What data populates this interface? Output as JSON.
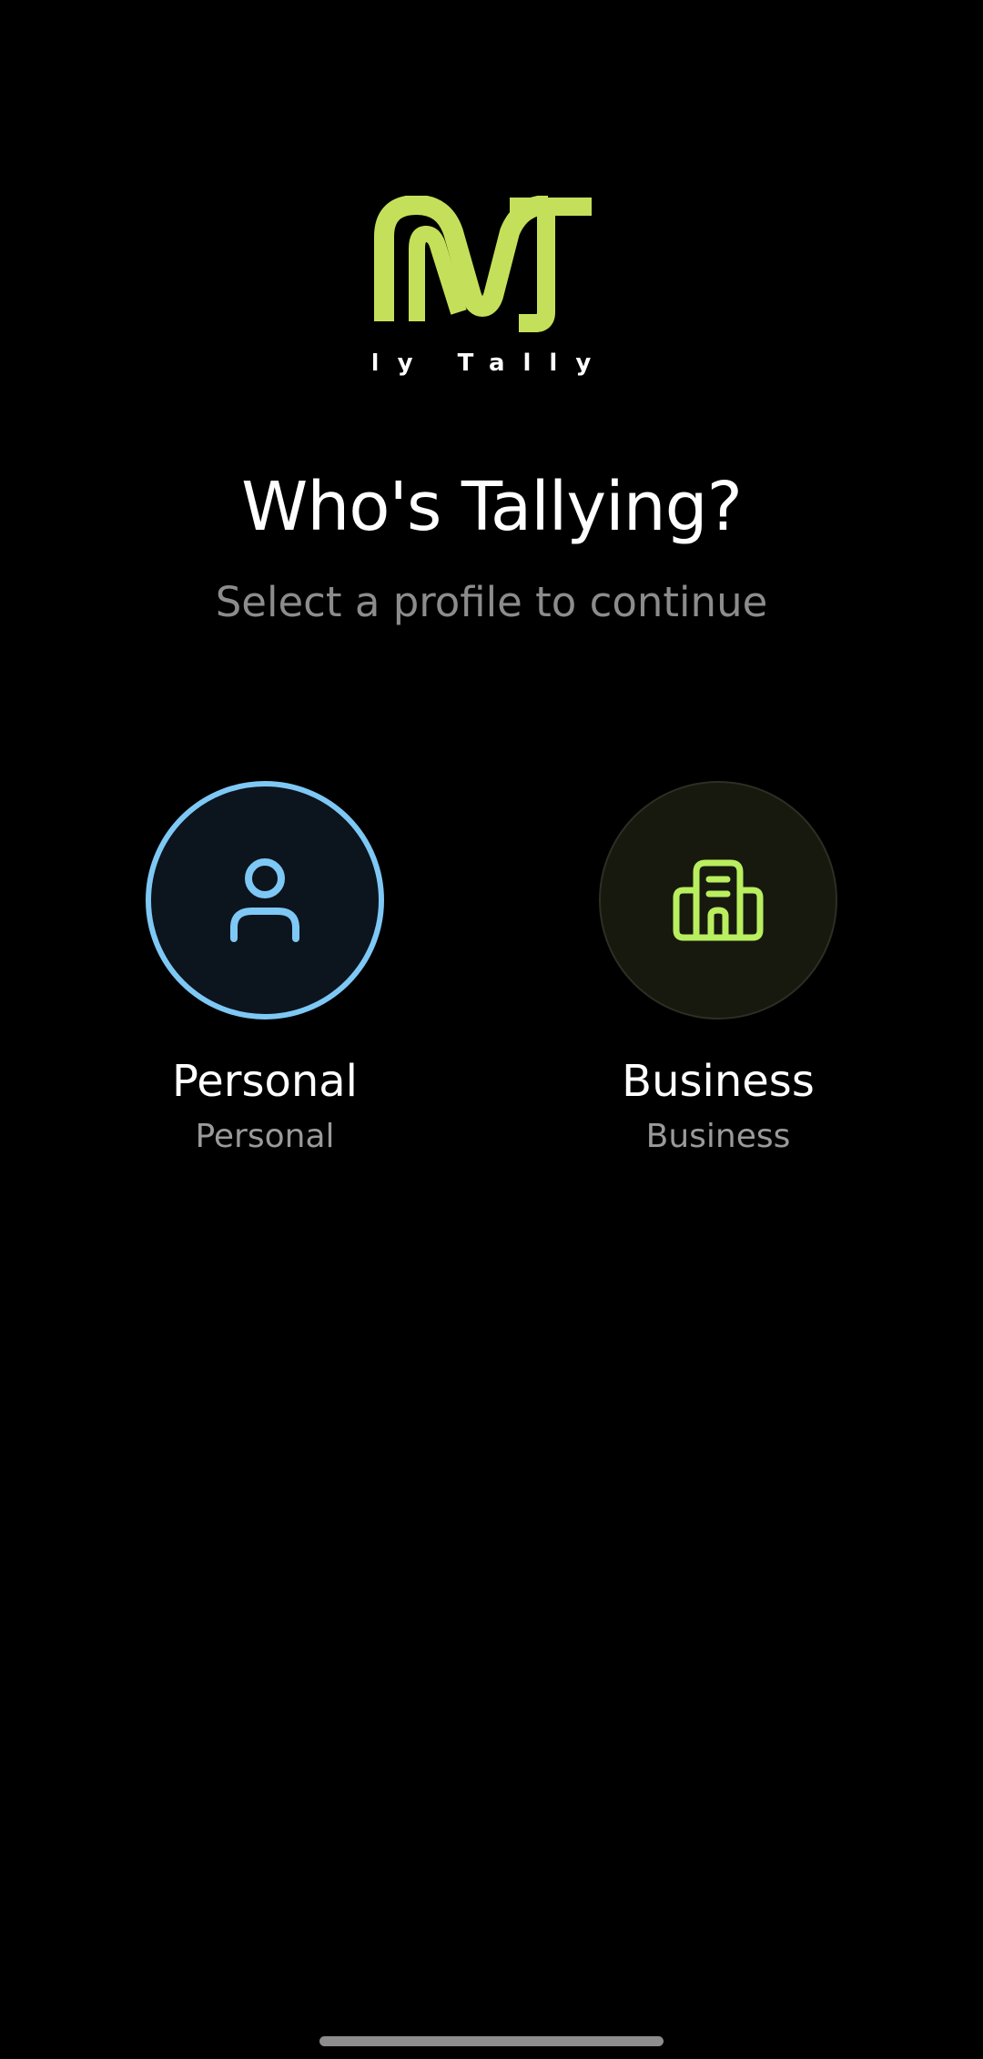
{
  "brand": {
    "logo_mark": "MT",
    "logo_text": "My Tally",
    "accent_color": "#c4e05a"
  },
  "header": {
    "title": "Who's Tallying?",
    "subtitle": "Select a profile to continue"
  },
  "profiles": [
    {
      "name": "Personal",
      "subtitle": "Personal",
      "icon": "user-icon",
      "color": "#7ec8f5",
      "selected": true
    },
    {
      "name": "Business",
      "subtitle": "Business",
      "icon": "building-icon",
      "color": "#b9ee5f",
      "selected": false
    }
  ]
}
